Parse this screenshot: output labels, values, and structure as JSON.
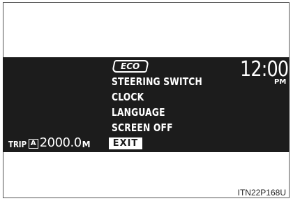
{
  "display": {
    "menu": {
      "eco_label": "ECO",
      "items": [
        "STEERING SWITCH",
        "CLOCK",
        "LANGUAGE",
        "SCREEN OFF"
      ],
      "exit_label": "EXIT"
    },
    "clock": {
      "time": "12:00",
      "period": "PM"
    },
    "trip": {
      "label": "TRIP",
      "id": "A",
      "value": "2000.0",
      "unit": "M"
    }
  },
  "figure_code": "ITN22P168U"
}
